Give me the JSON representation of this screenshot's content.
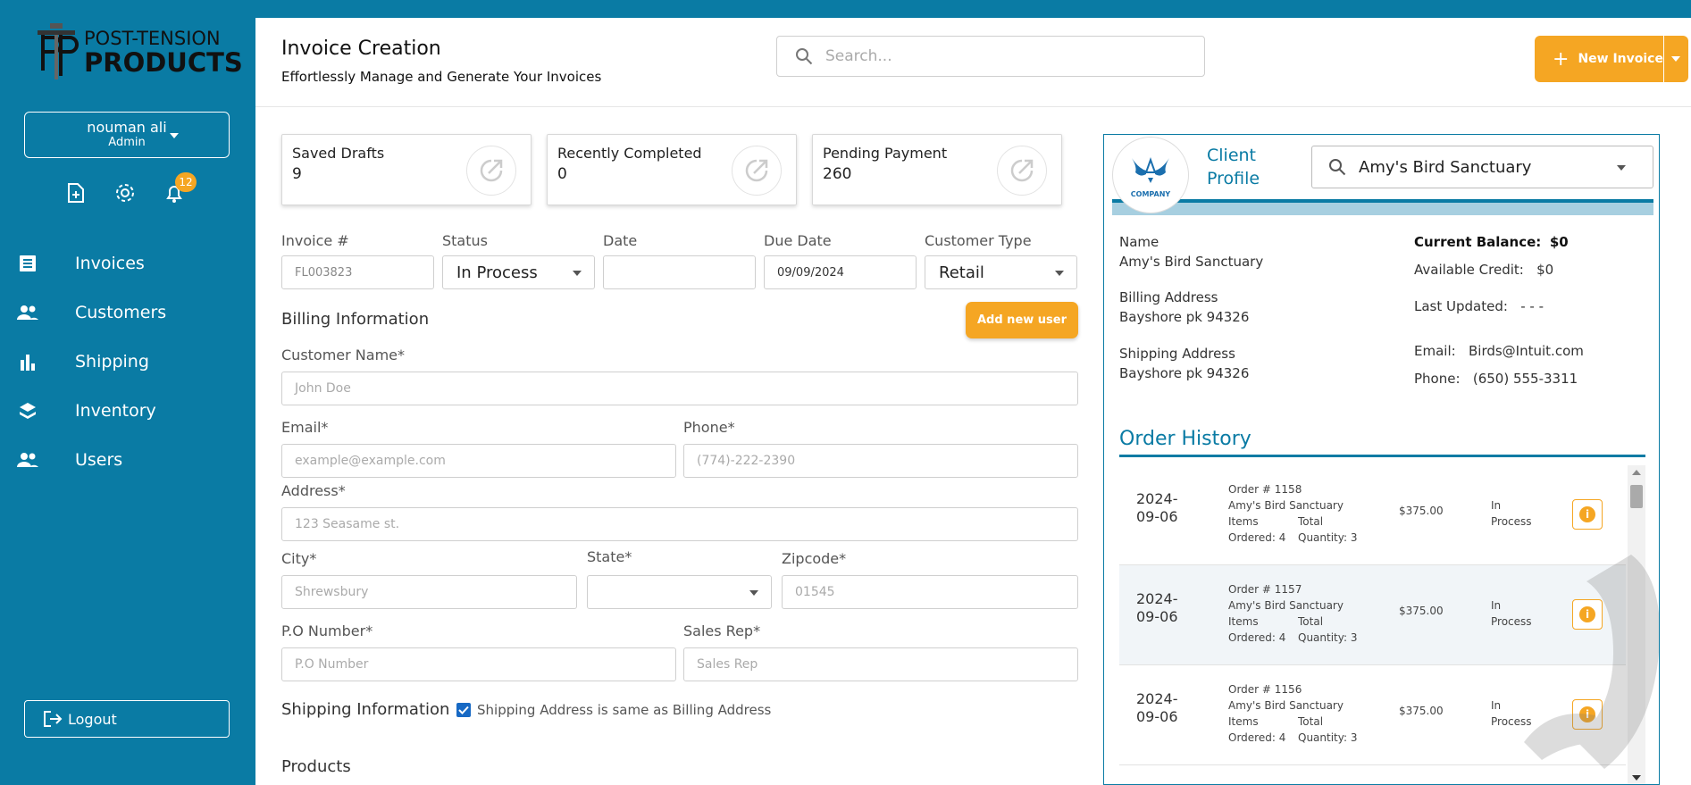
{
  "brand": {
    "line1": "POST-TENSION",
    "line2": "PRODUCTS"
  },
  "user": {
    "name": "nouman ali",
    "role": "Admin"
  },
  "notifications": {
    "count": "12"
  },
  "nav": [
    {
      "label": "Invoices",
      "icon": "invoices-icon"
    },
    {
      "label": "Customers",
      "icon": "customers-icon"
    },
    {
      "label": "Shipping",
      "icon": "shipping-icon"
    },
    {
      "label": "Inventory",
      "icon": "inventory-icon"
    },
    {
      "label": "Users",
      "icon": "users-icon"
    }
  ],
  "logout": {
    "label": "Logout"
  },
  "header": {
    "title": "Invoice Creation",
    "subtitle": "Effortlessly Manage and Generate Your Invoices",
    "search_placeholder": "Search...",
    "new_invoice_label": "New Invoice"
  },
  "stats": [
    {
      "label": "Saved Drafts",
      "value": "9"
    },
    {
      "label": "Recently Completed",
      "value": "0"
    },
    {
      "label": "Pending Payment",
      "value": "260"
    }
  ],
  "form": {
    "invoice_label": "Invoice #",
    "invoice_value": "FL003823",
    "status_label": "Status",
    "status_value": "In Process",
    "date_label": "Date",
    "date_value": "",
    "due_label": "Due Date",
    "due_value": "09/09/2024",
    "ctype_label": "Customer Type",
    "ctype_value": "Retail",
    "billing_title": "Billing Information",
    "add_user_label": "Add new user",
    "customer_label": "Customer Name*",
    "customer_placeholder": "John Doe",
    "email_label": "Email*",
    "email_placeholder": "example@example.com",
    "phone_label": "Phone*",
    "phone_placeholder": "(774)-222-2390",
    "address_label": "Address*",
    "address_placeholder": "123 Seasame st.",
    "city_label": "City*",
    "city_placeholder": "Shrewsbury",
    "state_label": "State*",
    "state_value": "",
    "zip_label": "Zipcode*",
    "zip_placeholder": "01545",
    "po_label": "P.O Number*",
    "po_placeholder": "P.O Number",
    "sales_label": "Sales Rep*",
    "sales_placeholder": "Sales Rep",
    "shipping_title": "Shipping Information",
    "same_address_label": "Shipping Address is same as Billing Address",
    "same_address_checked": true,
    "products_title": "Products"
  },
  "client": {
    "logo_text": "COMPANY",
    "profile_line1": "Client",
    "profile_line2": "Profile",
    "selected": "Amy's Bird Sanctuary",
    "name_label": "Name",
    "name_value": "Amy's Bird Sanctuary",
    "billing_label": "Billing Address",
    "billing_value": "Bayshore pk 94326",
    "shipping_label": "Shipping Address",
    "shipping_value": "Bayshore pk 94326",
    "balance_label": "Current Balance:",
    "balance_value": "$0",
    "credit_label": "Available Credit:",
    "credit_value": "$0",
    "updated_label": "Last Updated:",
    "updated_value": "- - -",
    "email_label": "Email:",
    "email_value": "Birds@Intuit.com",
    "phone_label": "Phone:",
    "phone_value": "(650) 555-3311"
  },
  "order_history": {
    "title": "Order History",
    "orders": [
      {
        "date1": "2024-",
        "date2": "09-06",
        "order": "Order # 1158",
        "customer": "Amy's Bird Sanctuary",
        "items_label": "Items",
        "total_label": "Total",
        "ordered": "Ordered: 4",
        "quantity": "Quantity: 3",
        "amount": "$375.00",
        "status1": "In",
        "status2": "Process"
      },
      {
        "date1": "2024-",
        "date2": "09-06",
        "order": "Order # 1157",
        "customer": "Amy's Bird Sanctuary",
        "items_label": "Items",
        "total_label": "Total",
        "ordered": "Ordered: 4",
        "quantity": "Quantity: 3",
        "amount": "$375.00",
        "status1": "In",
        "status2": "Process"
      },
      {
        "date1": "2024-",
        "date2": "09-06",
        "order": "Order # 1156",
        "customer": "Amy's Bird Sanctuary",
        "items_label": "Items",
        "total_label": "Total",
        "ordered": "Ordered: 4",
        "quantity": "Quantity: 3",
        "amount": "$375.00",
        "status1": "In",
        "status2": "Process"
      }
    ]
  },
  "colors": {
    "primary": "#0a7ba4",
    "accent": "#f5a623",
    "checkbox": "#1769c4"
  }
}
